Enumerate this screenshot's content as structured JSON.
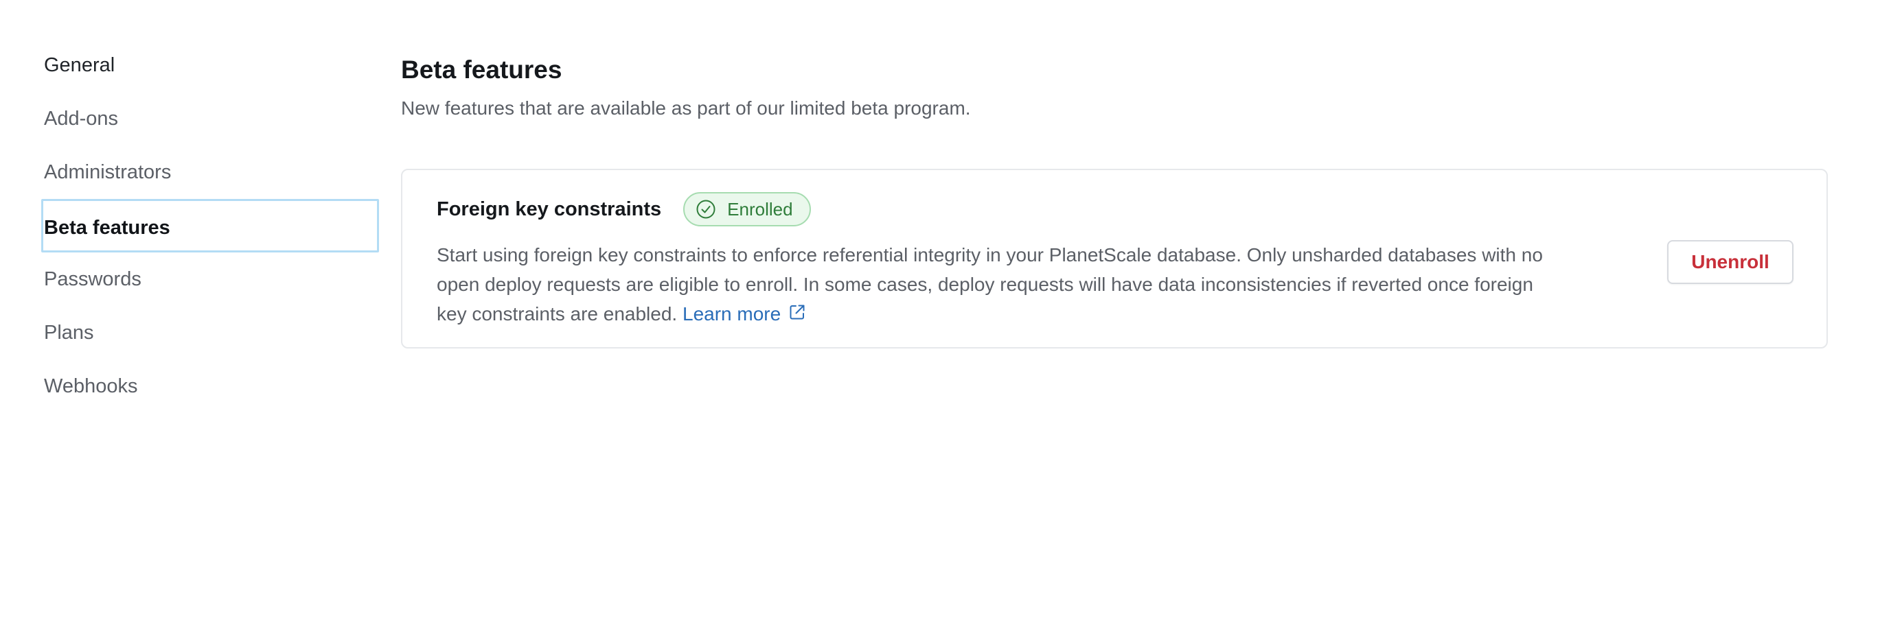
{
  "sidebar": {
    "items": [
      {
        "label": "General"
      },
      {
        "label": "Add-ons"
      },
      {
        "label": "Administrators"
      },
      {
        "label": "Beta features"
      },
      {
        "label": "Passwords"
      },
      {
        "label": "Plans"
      },
      {
        "label": "Webhooks"
      }
    ],
    "active_index": 3
  },
  "main": {
    "title": "Beta features",
    "subtitle": "New features that are available as part of our limited beta program.",
    "features": [
      {
        "title": "Foreign key constraints",
        "badge": "Enrolled",
        "badge_icon": "check-circle-icon",
        "description": "Start using foreign key constraints to enforce referential integrity in your PlanetScale database. Only unsharded databases with no open deploy requests are eligible to enroll. In some cases, deploy requests will have data inconsistencies if reverted once foreign key constraints are enabled.",
        "link_label": "Learn more",
        "link_icon": "external-link-icon",
        "action_label": "Unenroll"
      }
    ]
  },
  "colors": {
    "active_outline": "#b3dcf5",
    "badge_bg": "#eaf8ec",
    "badge_text": "#2f7d3a",
    "link": "#2a6db8",
    "danger": "#c8303a"
  }
}
